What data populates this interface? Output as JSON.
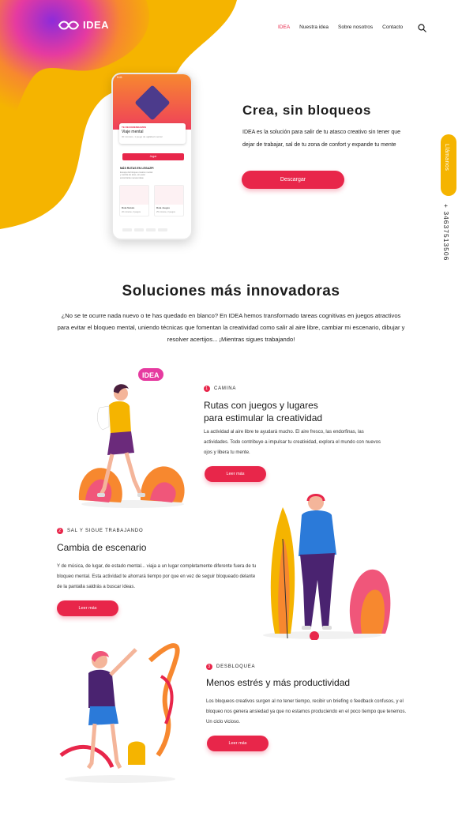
{
  "header": {
    "logo_text": "IDEA",
    "nav": [
      {
        "label": "IDEA",
        "active": true
      },
      {
        "label": "Nuestra idea",
        "active": false
      },
      {
        "label": "Sobre nosotros",
        "active": false
      },
      {
        "label": "Contacto",
        "active": false
      }
    ],
    "search_icon": "search-icon"
  },
  "sidebar_contact": {
    "call_label": "Llámanos",
    "phone": "+ 34637513506"
  },
  "phone_mockup": {
    "status": "9:41",
    "card_tag": "TE RECOMENDAMOS",
    "card_title": "Viaje mental",
    "card_sub": "30 minutos, 1 juego de agilidad mental",
    "button": "Jugar",
    "section_title": "MÁS RUTAS EN LEGAZPI",
    "section_desc": "Escapa del bloqueo creativo mental y cambia de aires, sin parar encontrarás nuevas ideas",
    "tiles": [
      {
        "title": "Ruta Natura",
        "sub": "20 minutos, 3 juegos"
      },
      {
        "title": "Ruta Juegos",
        "sub": "25 minutos, 3 juegos"
      }
    ]
  },
  "hero": {
    "title": "Crea, sin bloqueos",
    "text": "IDEA es la solución para salir de tu atasco creativo sin tener que dejar de trabajar, sal de tu zona de confort y expande tu mente",
    "button": "Descargar"
  },
  "solutions": {
    "title": "Soluciones más innovadoras",
    "text": "¿No se te ocurre nada nuevo o te has quedado en blanco? En IDEA hemos transformado tareas cognitivas en juegos atractivos para evitar el bloqueo mental, uniendo técnicas que fomentan la creatividad como salir al aire libre, cambiar mi escenario, dibujar y resolver acertijos... ¡Mientras sigues trabajando!"
  },
  "steps": [
    {
      "num": "1",
      "tag": "CAMINA",
      "title_line1": "Rutas con juegos y lugares",
      "title_line2": "para estimular la creatividad",
      "text": "La actividad al aire libre te ayudará mucho. El aire fresco, las endorfinas, las actividades. Todo contribuye a impulsar tu creatividad, explora el mundo con nuevos ojos y libera tu mente.",
      "button": "Leer más",
      "badge": "IDEA"
    },
    {
      "num": "2",
      "tag": "SAL Y SIGUE TRABAJANDO",
      "title_line1": "Cambia de escenario",
      "title_line2": "",
      "text": "Y de música, de lugar, de estado mental... viaja a un lugar completamente diferente fuera de tu bloqueo mental. Esta actividad te ahorrará tiempo por que en vez de seguir bloqueado delante de la pantalla saldrás a buscar ideas.",
      "button": "Leer más"
    },
    {
      "num": "3",
      "tag": "DESBLOQUEA",
      "title_line1": "Menos estrés y más productividad",
      "title_line2": "",
      "text": "Los bloqueos creativos surgen al no tener tiempo, recibir un briefing o feedback confusos, y el bloqueo nos genera ansiedad ya que no estamos produciendo en el poco tiempo que tenemos. Un ciclo vicioso.",
      "button": "Leer más"
    }
  ],
  "colors": {
    "accent": "#e8264a",
    "yellow": "#f5b400",
    "purple": "#8e2bd9"
  }
}
